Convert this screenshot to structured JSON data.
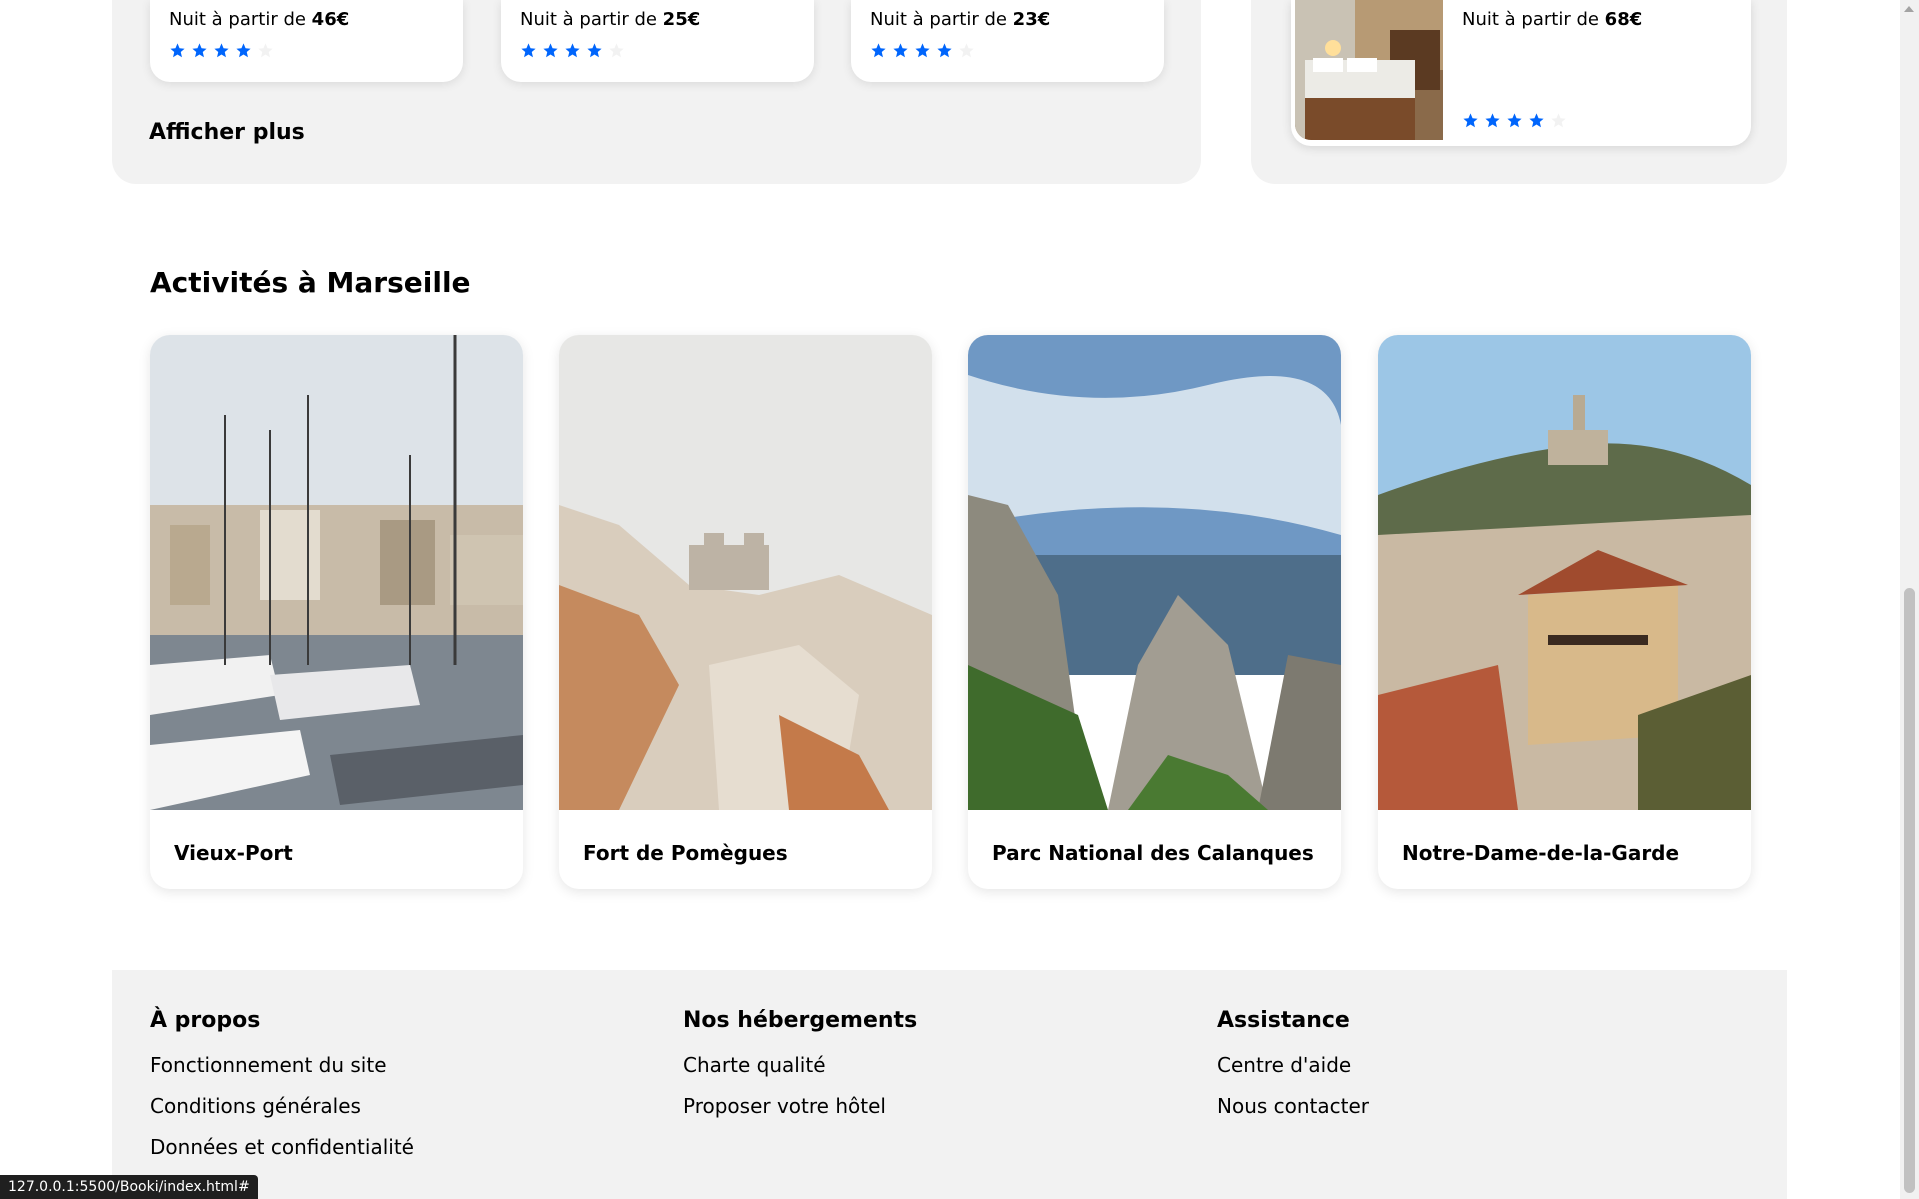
{
  "hotels_panel": {
    "cards": [
      {
        "price_prefix": "Nuit à partir de ",
        "price": "46€",
        "rating": 4,
        "max_rating": 5
      },
      {
        "price_prefix": "Nuit à partir de ",
        "price": "25€",
        "rating": 4,
        "max_rating": 5
      },
      {
        "price_prefix": "Nuit à partir de ",
        "price": "23€",
        "rating": 4,
        "max_rating": 5
      }
    ],
    "show_more": "Afficher plus"
  },
  "popular_panel": {
    "card": {
      "price_prefix": "Nuit à partir de ",
      "price": "68€",
      "rating": 4,
      "max_rating": 5
    }
  },
  "activities": {
    "title": "Activités à Marseille",
    "items": [
      {
        "name": "Vieux-Port"
      },
      {
        "name": "Fort de Pomègues"
      },
      {
        "name": "Parc National des Calanques"
      },
      {
        "name": "Notre-Dame-de-la-Garde"
      }
    ]
  },
  "footer": {
    "columns": [
      {
        "title": "À propos",
        "links": [
          "Fonctionnement du site",
          "Conditions générales",
          "Données et confidentialité"
        ]
      },
      {
        "title": "Nos hébergements",
        "links": [
          "Charte qualité",
          "Proposer votre hôtel"
        ]
      },
      {
        "title": "Assistance",
        "links": [
          "Centre d'aide",
          "Nous contacter"
        ]
      }
    ]
  },
  "status_bar": {
    "url": "127.0.0.1:5500/Booki/index.html#"
  },
  "colors": {
    "accent": "#0065fc",
    "panel_bg": "#f2f2f2"
  }
}
